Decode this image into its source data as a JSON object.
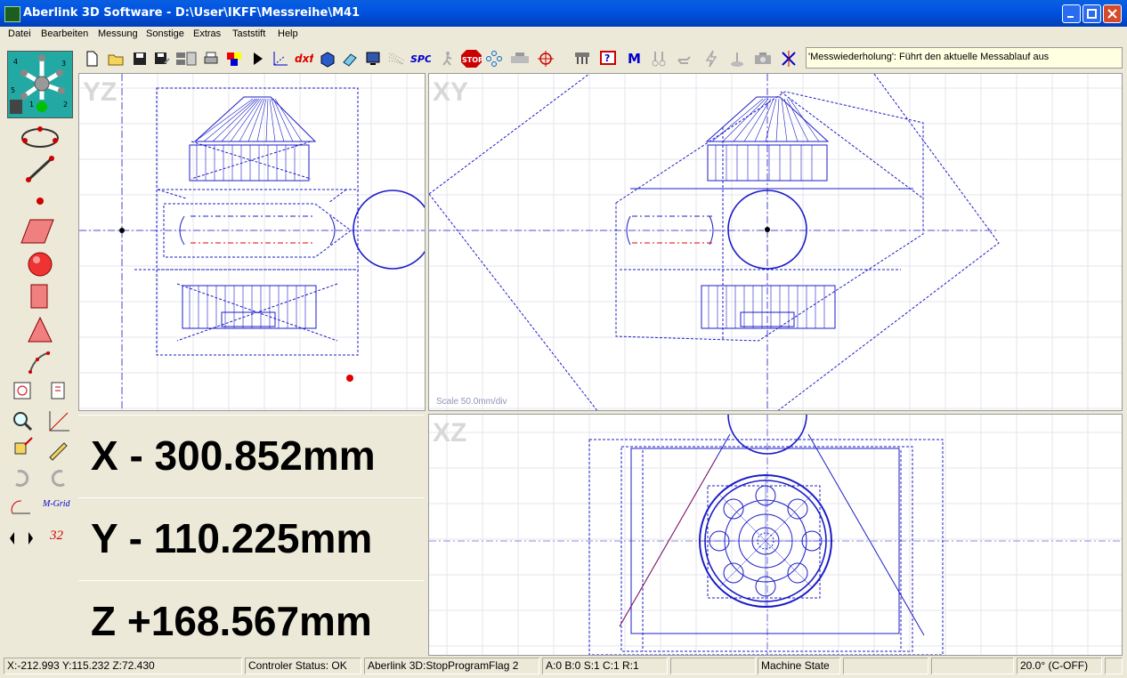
{
  "window": {
    "title": "Aberlink 3D Software - D:\\User\\IKFF\\Messreihe\\M41"
  },
  "menu": [
    "Datei",
    "Bearbeiten",
    "Messung",
    "Sonstige",
    "Extras",
    "Taststift",
    "Help"
  ],
  "toolbar": {
    "icons": [
      "new-file-icon",
      "open-folder-icon",
      "save-icon",
      "save-as-icon",
      "feature-table-icon",
      "print-icon",
      "colors-icon",
      "run-program-icon",
      "axis-alignment-icon",
      "dxf-icon",
      "cube-icon",
      "eraser-icon",
      "monitor-icon",
      "grid-pattern-icon",
      "spc-icon",
      "walker-icon",
      "stop-icon",
      "points-cloud-icon",
      "machine-icon",
      "crosshair-icon",
      "probe-rack-icon",
      "help-icon",
      "m-icon",
      "probe-pair-icon",
      "hand-icon",
      "lightning-icon",
      "joystick-icon",
      "camera-icon",
      "x-cross-icon"
    ],
    "dxf_label": "dxf",
    "spc_label": "SPC",
    "stop_label": "STOP",
    "m_label": "M"
  },
  "message": "'Messwiederholung': Führt den aktuelle Messablauf aus",
  "probe_panel": {
    "labels": [
      "4",
      "3",
      "5",
      "1",
      "2"
    ],
    "indicator_color": "#00c000"
  },
  "left_tools": {
    "mgrid_label": "M-Grid",
    "probe_count": "32"
  },
  "views": {
    "yz": {
      "label": "YZ"
    },
    "xy": {
      "label": "XY",
      "scale": "Scale 50.0mm/div"
    },
    "xz": {
      "label": "XZ"
    }
  },
  "coords": {
    "x": "X - 300.852mm",
    "y": "Y - 110.225mm",
    "z": "Z +168.567mm"
  },
  "status": {
    "position": "X:-212.993 Y:115.232 Z:72.430",
    "controller": "Controler Status: OK",
    "flag": "Aberlink 3D:StopProgramFlag 2",
    "axes": "A:0  B:0  S:1  C:1  R:1",
    "machine": "Machine State",
    "temp": "20.0° (C-OFF)"
  },
  "colors": {
    "drawing": "#1c1cc8",
    "red_line": "#e00000",
    "accent": "#0054e3"
  }
}
